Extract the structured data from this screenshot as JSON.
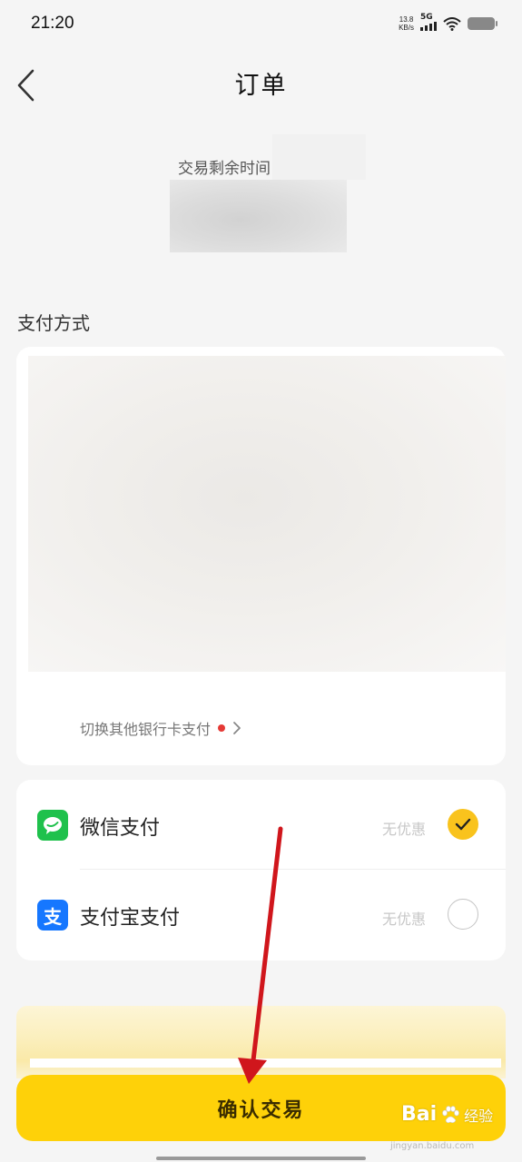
{
  "status_bar": {
    "time": "21:20",
    "net_speed_value": "13.8",
    "net_speed_unit": "KB/s",
    "network_type": "5G",
    "icons": [
      "signal-icon",
      "wifi-icon",
      "battery-icon"
    ]
  },
  "header": {
    "title": "订单",
    "back_icon": "chevron-left-icon"
  },
  "countdown": {
    "label": "交易剩余时间"
  },
  "payment_section": {
    "title": "支付方式",
    "switch_bank_label": "切换其他银行卡支付",
    "methods": [
      {
        "name": "微信支付",
        "discount": "无优惠",
        "selected": true,
        "icon": "wechat-pay-icon"
      },
      {
        "name": "支付宝支付",
        "discount": "无优惠",
        "selected": false,
        "icon": "alipay-icon",
        "icon_glyph": "支"
      }
    ]
  },
  "footer": {
    "confirm_label": "确认交易"
  },
  "watermark": {
    "brand": "Bai",
    "brand_suffix": "经验",
    "url": "jingyan.baidu.com"
  },
  "colors": {
    "accent": "#FED109",
    "check": "#F9C31D",
    "wechat": "#1FC14C",
    "alipay": "#1677FF",
    "arrow": "#D0161C",
    "notice_dot": "#E53935"
  }
}
